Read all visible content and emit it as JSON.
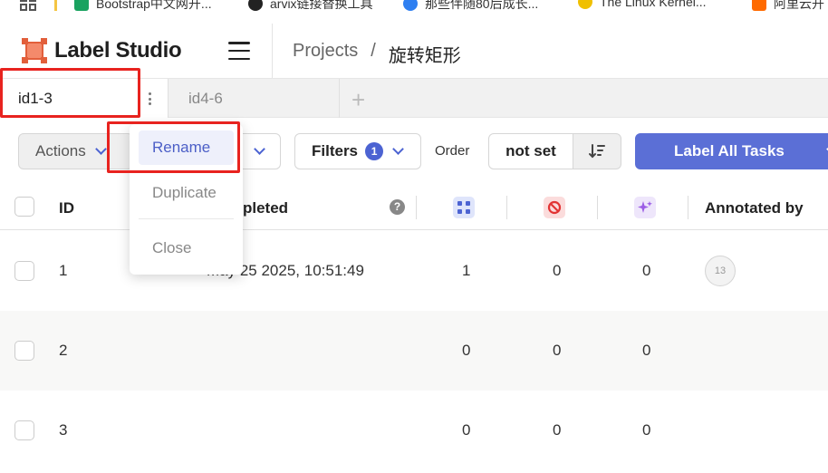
{
  "bookmarks": [
    {
      "label": "Bootstrap中文网开...",
      "icon": "bootstrap-icon",
      "color": "#1aa260"
    },
    {
      "label": "arvix链接替换工具",
      "icon": "github-icon",
      "color": "#222222"
    },
    {
      "label": "那些伴随80后成长...",
      "icon": "k-icon",
      "color": "#2e7ff1"
    },
    {
      "label": "The Linux Kernel...",
      "icon": "linux-icon",
      "color": "#f0c000"
    },
    {
      "label": "阿里云开",
      "icon": "aliyun-icon",
      "color": "#ff6a00"
    }
  ],
  "app": {
    "name": "Label Studio",
    "brand_color": "#e25f3b"
  },
  "breadcrumb": {
    "root": "Projects",
    "separator": "/",
    "current": "旋转矩形"
  },
  "tabs": [
    {
      "label": "id1-3",
      "active": true
    },
    {
      "label": "id4-6",
      "active": false
    }
  ],
  "tab_add_label": "+",
  "toolbar": {
    "actions_label": "Actions",
    "filters_label": "Filters",
    "filters_count": "1",
    "order_label": "Order",
    "order_value": "not set",
    "label_all_label": "Label All Tasks",
    "accent_color": "#5b6fd6"
  },
  "context_menu": {
    "items": [
      "Rename",
      "Duplicate",
      "Close"
    ],
    "selected": "Rename"
  },
  "table": {
    "headers": {
      "id": "ID",
      "completed": "pleted",
      "annotated_by": "Annotated by",
      "help": "?"
    },
    "rows": [
      {
        "id": "1",
        "completed": "May 25 2025, 10:51:49",
        "annotations": "1",
        "cancelled": "0",
        "predictions": "0",
        "annotator": "13"
      },
      {
        "id": "2",
        "completed": "",
        "annotations": "0",
        "cancelled": "0",
        "predictions": "0",
        "annotator": ""
      },
      {
        "id": "3",
        "completed": "",
        "annotations": "0",
        "cancelled": "0",
        "predictions": "0",
        "annotator": ""
      }
    ]
  }
}
